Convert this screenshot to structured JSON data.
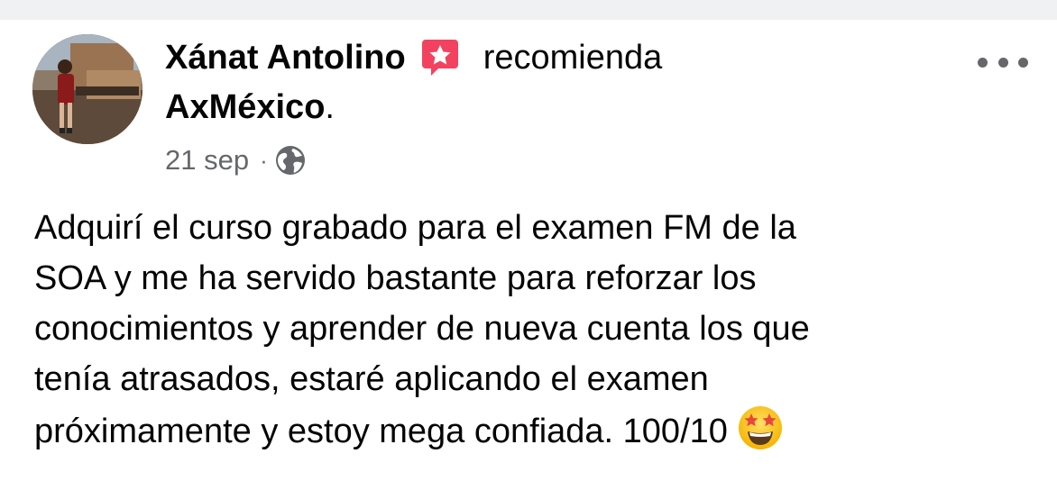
{
  "post": {
    "author_name": "Xánat Antolino",
    "action": "recomienda",
    "page_name": "AxMéxico",
    "page_suffix": ".",
    "timestamp": "21 sep",
    "separator": "·",
    "privacy_icon": "globe-icon",
    "recommend_icon": "recommend-star-badge-icon",
    "more_icon": "more-options-icon",
    "body_lines": [
      "Adquirí el curso grabado para el examen FM de la",
      "SOA y me ha servido bastante para reforzar los",
      "conocimientos y aprender de nueva cuenta los que",
      "tenía atrasados, estaré aplicando el examen",
      "próximamente y estoy mega confiada. 100/10"
    ],
    "trailing_emoji": "star-struck-emoji"
  },
  "colors": {
    "text_primary": "#050505",
    "text_secondary": "#65676b",
    "recommend_badge": "#f3425f",
    "top_strip": "#f0f1f3"
  }
}
